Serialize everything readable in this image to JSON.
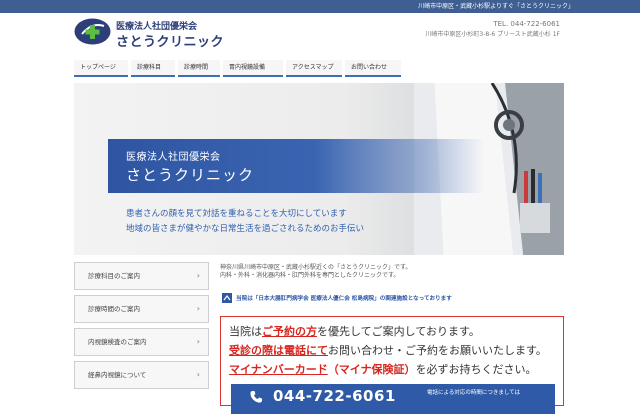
{
  "top_bar": {
    "tagline": "川崎市中原区・武蔵小杉駅よりすぐ「さとうクリニック」"
  },
  "header": {
    "logo_sub": "医療法人社団優栄会",
    "logo_main": "さとうクリニック",
    "tel": "TEL. 044-722-6061",
    "address": "川崎市中原区小杉町3-8-6 プリースト武蔵小杉 1F"
  },
  "nav": {
    "items": [
      {
        "label": "トップページ"
      },
      {
        "label": "診療科目"
      },
      {
        "label": "診療時間"
      },
      {
        "label": "胃内視鏡設備"
      },
      {
        "label": "アクセスマップ"
      },
      {
        "label": "お問い合わせ"
      }
    ]
  },
  "hero": {
    "band_sub": "医療法人社団優栄会",
    "band_main": "さとうクリニック",
    "copy_line1": "患者さんの顔を見て対話を重ねることを大切にしています",
    "copy_line2": "地域の皆さまが健やかな日常生活を過ごされるためのお手伝い"
  },
  "sidebar": {
    "items": [
      {
        "label": "診療科目のご案内"
      },
      {
        "label": "診療時間のご案内"
      },
      {
        "label": "内視鏡検査のご案内"
      },
      {
        "label": "経鼻内視鏡について"
      }
    ]
  },
  "main": {
    "intro_line1": "神奈川県川崎市中原区・武蔵小杉駅近くの「さとうクリニック」です。",
    "intro_line2": "内科・外科・消化器内科・肛門外科を専門としたクリニックです。",
    "association": "当院は「日本大腸肛門病学会 医療法人優仁会 松島病院」の関連施設となっております",
    "notice": {
      "line1_a": "当院は",
      "line1_b": "ご予約の方",
      "line1_c": "を優先してご案内しております。",
      "line2_a": "受診の際は電話にて",
      "line2_b": "お問い合わせ・ご予約をお願いいたします。",
      "line3_a": "マイナンバーカード",
      "line3_b": "（マイナ保険証）",
      "line3_c": "を必ずお持ちください。",
      "phone": "044-722-6061",
      "phone_note": "電話による対応の時間につきましては"
    }
  },
  "colors": {
    "brand_navy": "#2c3f78",
    "accent_blue": "#3d6fb5",
    "alert_red": "#d8261f"
  }
}
